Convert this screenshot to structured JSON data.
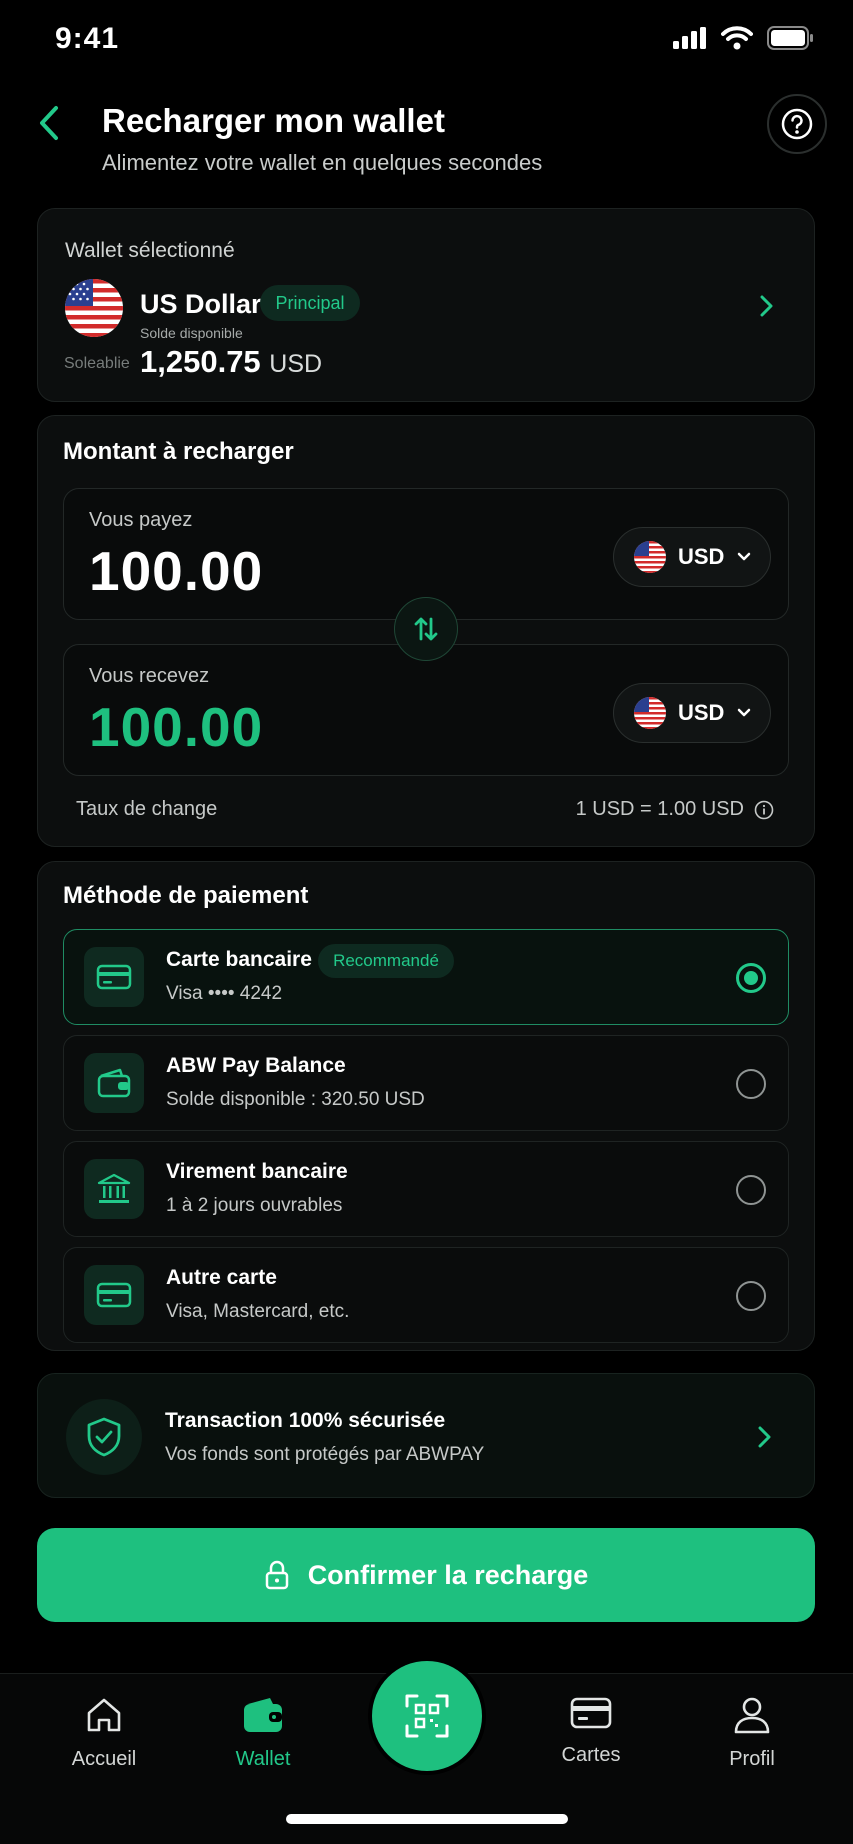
{
  "status_bar": {
    "time": "9:41"
  },
  "header": {
    "title": "Recharger mon wallet",
    "subtitle": "Alimentez votre wallet en quelques secondes"
  },
  "wallet": {
    "label": "Wallet sélectionné",
    "name": "US Dollar",
    "badge": "Principal",
    "balance_label": "Solde disponible",
    "balance_ghost": "Soleablie",
    "balance": "1,250.75",
    "currency": "USD"
  },
  "amount": {
    "title": "Montant à recharger",
    "pay_label": "Vous payez",
    "pay_value": "100.00",
    "pay_currency": "USD",
    "receive_label": "Vous recevez",
    "receive_value": "100.00",
    "receive_currency": "USD",
    "rate_label": "Taux de change",
    "rate_value": "1 USD = 1.00 USD"
  },
  "payment": {
    "title": "Méthode de paiement",
    "methods": [
      {
        "title": "Carte bancaire",
        "badge": "Recommandé",
        "subtitle": "Visa •••• 4242",
        "icon": "credit-card-icon",
        "selected": true
      },
      {
        "title": "ABW Pay Balance",
        "subtitle": "Solde disponible : 320.50 USD",
        "icon": "wallet-icon",
        "selected": false
      },
      {
        "title": "Virement bancaire",
        "subtitle": "1 à 2 jours ouvrables",
        "icon": "bank-icon",
        "selected": false
      },
      {
        "title": "Autre carte",
        "subtitle": "Visa, Mastercard, etc.",
        "icon": "credit-card-icon",
        "selected": false
      }
    ]
  },
  "security": {
    "title": "Transaction 100% sécurisée",
    "subtitle": "Vos fonds sont protégés par ABWPAY"
  },
  "confirm_label": "Confirmer la recharge",
  "nav": {
    "items": [
      {
        "label": "Accueil",
        "icon": "home-icon"
      },
      {
        "label": "Wallet",
        "icon": "wallet-icon",
        "active": true
      },
      {
        "label": "Cartes",
        "icon": "card-icon"
      },
      {
        "label": "Profil",
        "icon": "user-icon"
      }
    ],
    "scan_icon": "scan-qr-icon"
  },
  "colors": {
    "accent": "#1ec07f",
    "background": "#000000",
    "card": "#0c0e0e"
  }
}
